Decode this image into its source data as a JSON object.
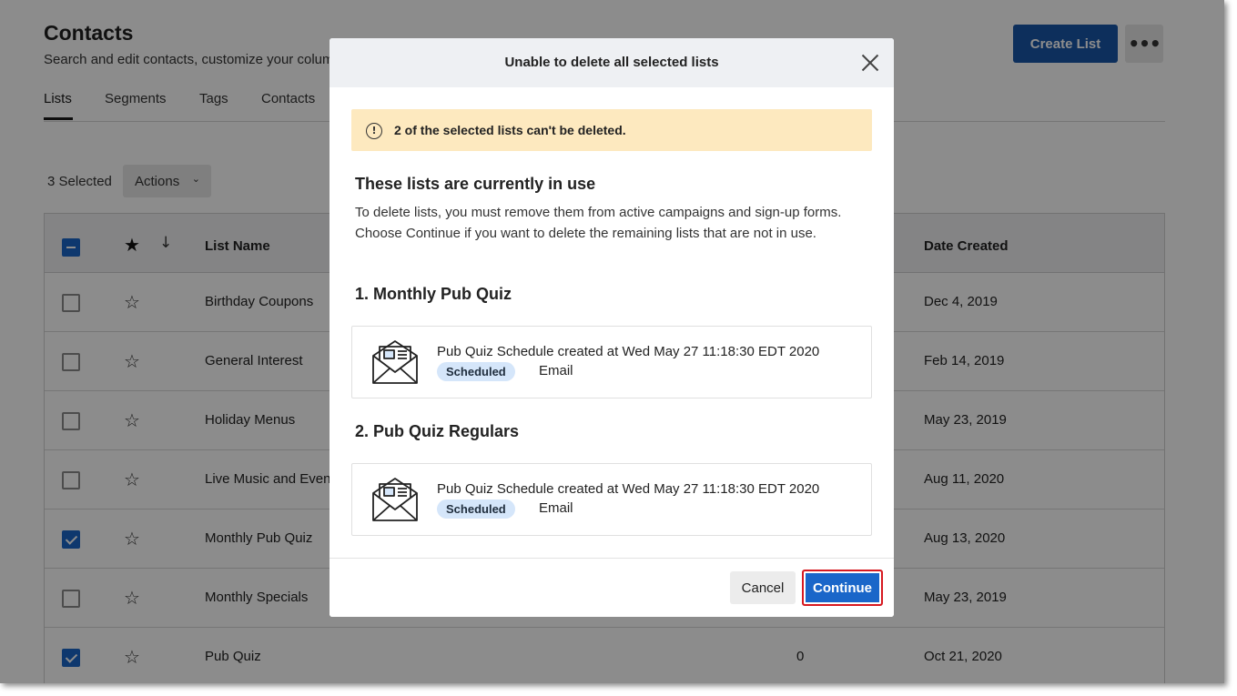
{
  "page": {
    "title": "Contacts",
    "subtitle": "Search and edit contacts, customize your colum",
    "create_button": "Create List",
    "more_button": "•••"
  },
  "tabs": [
    "Lists",
    "Segments",
    "Tags",
    "Contacts"
  ],
  "toolbar": {
    "selected_count": "3 Selected",
    "actions_label": "Actions"
  },
  "table": {
    "headers": {
      "name": "List Name",
      "date": "Date Created"
    },
    "rows": [
      {
        "name": "Birthday Coupons",
        "count": "",
        "date": "Dec 4, 2019",
        "checked": false
      },
      {
        "name": "General Interest",
        "count": "",
        "date": "Feb 14, 2019",
        "checked": false
      },
      {
        "name": "Holiday Menus",
        "count": "",
        "date": "May 23, 2019",
        "checked": false
      },
      {
        "name": "Live Music and Event",
        "count": "",
        "date": "Aug 11, 2020",
        "checked": false
      },
      {
        "name": "Monthly Pub Quiz",
        "count": "",
        "date": "Aug 13, 2020",
        "checked": true
      },
      {
        "name": "Monthly Specials",
        "count": "",
        "date": "May 23, 2019",
        "checked": false
      },
      {
        "name": "Pub Quiz",
        "count": "0",
        "date": "Oct 21, 2020",
        "checked": true
      }
    ]
  },
  "modal": {
    "title": "Unable to delete all selected lists",
    "warning": "2 of the selected lists can't be deleted.",
    "heading": "These lists are currently in use",
    "description": "To delete lists, you must remove them from active campaigns and sign-up forms. Choose Continue if you want to delete the remaining lists that are not in use.",
    "lists": [
      {
        "heading": "1.  Monthly Pub Quiz",
        "campaign": "Pub Quiz Schedule created at Wed May 27 11:18:30 EDT 2020",
        "status": "Scheduled",
        "type": "Email"
      },
      {
        "heading": "2.  Pub Quiz Regulars",
        "campaign": "Pub Quiz Schedule created at Wed May 27 11:18:30 EDT 2020",
        "status": "Scheduled",
        "type": "Email"
      }
    ],
    "cancel_label": "Cancel",
    "continue_label": "Continue"
  },
  "colors": {
    "primary": "#1856a8",
    "checkbox": "#1a66c9",
    "warning_bg": "#fde9bf",
    "badge_bg": "#d5e6fa",
    "highlight_border": "#d71920"
  }
}
